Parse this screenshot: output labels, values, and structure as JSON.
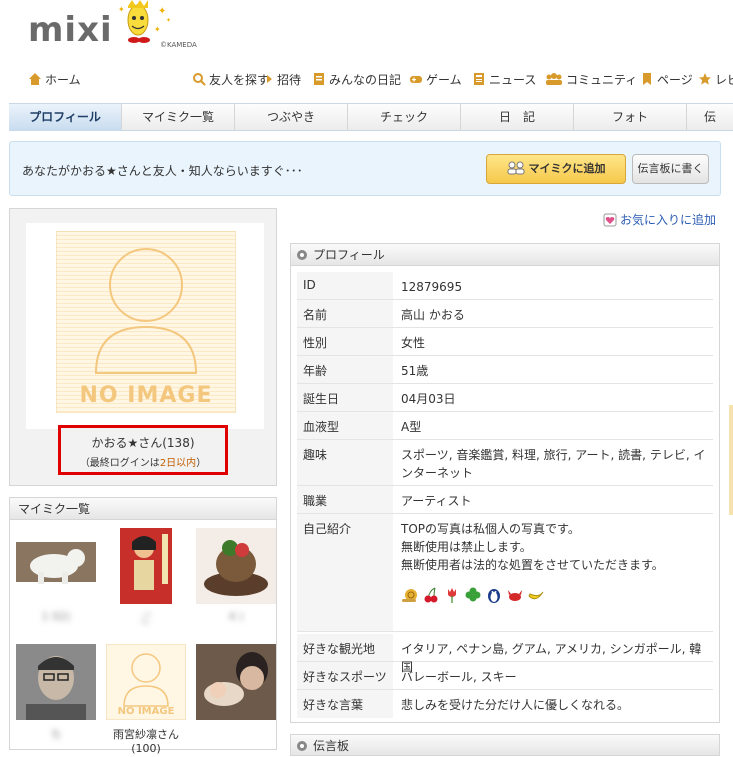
{
  "header": {
    "logo_text": "mixi",
    "copyright": "©KAMEDA"
  },
  "global_nav": [
    {
      "label": "ホーム",
      "icon": "home-icon"
    },
    {
      "label": "友人を探す",
      "icon": "search-icon"
    },
    {
      "label": "招待",
      "icon": "arrow-icon"
    },
    {
      "label": "みんなの日記",
      "icon": "diary-icon"
    },
    {
      "label": "ゲーム",
      "icon": "gamepad-icon"
    },
    {
      "label": "ニュース",
      "icon": "news-icon"
    },
    {
      "label": "コミュニティ",
      "icon": "people-icon"
    },
    {
      "label": "ページ",
      "icon": "bookmark-icon"
    },
    {
      "label": "レビ",
      "icon": "star-icon"
    }
  ],
  "tabs": [
    "プロフィール",
    "マイミク一覧",
    "つぶやき",
    "チェック",
    "日　記",
    "フォト",
    "伝"
  ],
  "friend_request": {
    "message": "あなたがかおる★さんと友人・知人ならいますぐ･･･",
    "add_button": "マイミクに追加",
    "board_button": "伝言板に書く"
  },
  "profile_card": {
    "no_image": "NO IMAGE",
    "name": "かおる★さん(138)",
    "login_prefix": "（最終ログインは",
    "login_value": "2日以内",
    "login_suffix": "）"
  },
  "favorite_link": "お気に入りに追加",
  "mymixi": {
    "title": "マイミク一覧",
    "friends": [
      {
        "label": "1 02)",
        "photo": "polar-bear"
      },
      {
        "label": "ご",
        "photo": "book-cover"
      },
      {
        "label": "4 )",
        "photo": "cake"
      },
      {
        "label": "ち",
        "photo": "man"
      },
      {
        "label": "雨宮紗凛さん",
        "sub": "(100)",
        "photo": "no-image"
      },
      {
        "label": "",
        "photo": "baby"
      }
    ],
    "no_image_small": "NO IMAGE"
  },
  "profile": {
    "title": "プロフィール",
    "rows": [
      {
        "key": "ID",
        "value": "12879695"
      },
      {
        "key": "名前",
        "value": "高山 かおる"
      },
      {
        "key": "性別",
        "value": "女性"
      },
      {
        "key": "年齢",
        "value": "51歳"
      },
      {
        "key": "誕生日",
        "value": "04月03日"
      },
      {
        "key": "血液型",
        "value": "A型"
      },
      {
        "key": "趣味",
        "value": "スポーツ, 音楽鑑賞, 料理, 旅行, アート, 読書, テレビ, インターネット"
      },
      {
        "key": "職業",
        "value": "アーティスト"
      },
      {
        "key": "自己紹介",
        "lines": [
          "TOPの写真は私個人の写真です。",
          "無断使用は禁止します。",
          "無断使用者は法的な処置をさせていただきます。"
        ]
      },
      {
        "key": "好きな観光地",
        "value": "イタリア, ペナン島, グアム, アメリカ, シンガポール, 韓国"
      },
      {
        "key": "好きなスポーツ",
        "value": "バレーボール, スキー"
      },
      {
        "key": "好きな言葉",
        "value": "悲しみを受けた分だけ人に優しくなれる。"
      }
    ]
  },
  "board": {
    "title": "伝言板"
  },
  "colors": {
    "link": "#2b5cb3",
    "accent_red": "#e00000",
    "login_highlight": "#c35f00",
    "button_yellow": "#f6c84a"
  }
}
